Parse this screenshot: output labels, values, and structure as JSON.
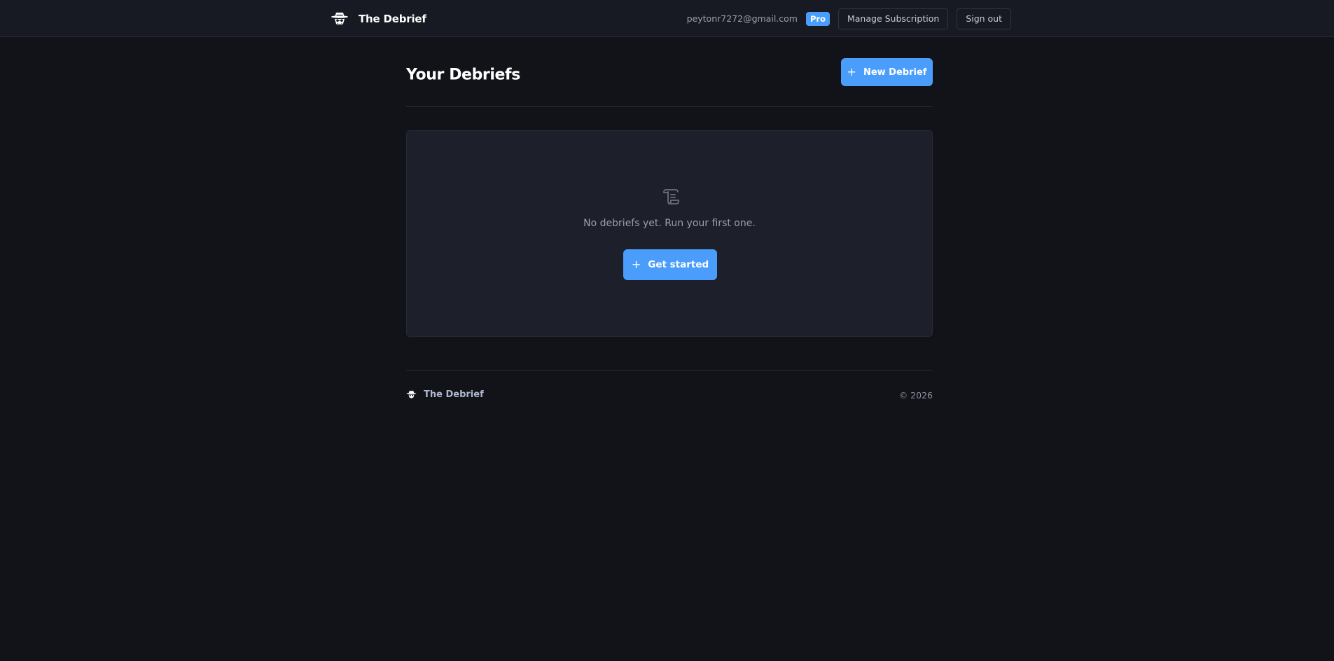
{
  "header": {
    "brand_name": "The Debrief",
    "logo_icon": "spy-hat-icon",
    "user_email": "peytonr7272@gmail.com",
    "plan_badge": "Pro",
    "manage_label": "Manage Subscription",
    "signout_label": "Sign out"
  },
  "main": {
    "title": "Your Debriefs",
    "new_button_label": "New Debrief",
    "empty_state": {
      "icon": "scroll-icon",
      "message": "No debriefs yet. Run your first one.",
      "cta_label": "Get started"
    }
  },
  "footer": {
    "brand_name": "The Debrief",
    "copyright": "© 2026"
  },
  "colors": {
    "background": "#111318",
    "header": "#171a22",
    "card": "#1d1f2a",
    "accent": "#4b9dfb"
  }
}
